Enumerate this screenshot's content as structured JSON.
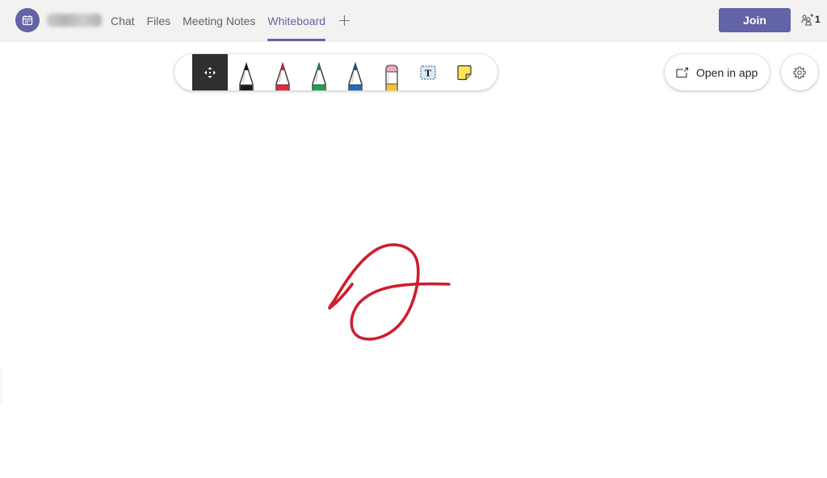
{
  "header": {
    "meeting_name": "(blurred meeting name)",
    "tabs": [
      {
        "label": "Chat",
        "active": false
      },
      {
        "label": "Files",
        "active": false
      },
      {
        "label": "Meeting Notes",
        "active": false
      },
      {
        "label": "Whiteboard",
        "active": true
      }
    ],
    "add_tab_icon": "+",
    "join_label": "Join",
    "participant_count": "1",
    "accent_color": "#6264a7"
  },
  "toolbar": {
    "tools": [
      {
        "name": "lasso-select",
        "icon": "move-arrows",
        "selected": true
      },
      {
        "name": "black-pen",
        "color": "#1a1a1a"
      },
      {
        "name": "red-pen",
        "color": "#c4262e"
      },
      {
        "name": "green-pen",
        "color": "#1f8a4c"
      },
      {
        "name": "blue-pen",
        "color": "#1f6bbf"
      },
      {
        "name": "eraser",
        "color": "#f0a7c8"
      },
      {
        "name": "text-box",
        "glyph": "T"
      },
      {
        "name": "sticky-note",
        "color": "#ffe45c"
      }
    ]
  },
  "actions": {
    "open_in_app_label": "Open in app",
    "settings": "gear-icon"
  },
  "canvas": {
    "ink_color": "#cc1f2f",
    "ink_strokes": 1
  }
}
